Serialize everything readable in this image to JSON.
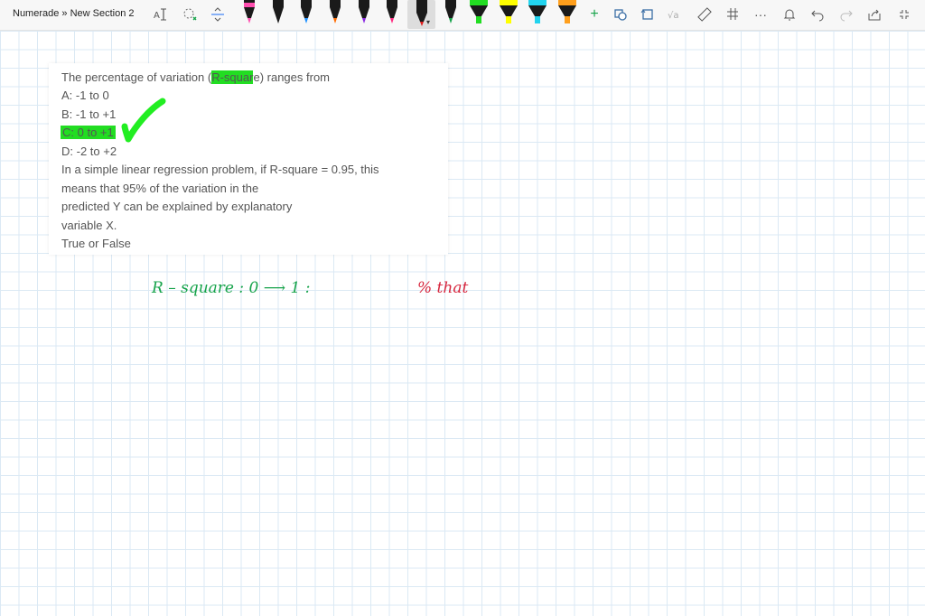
{
  "toolbar": {
    "breadcrumb": "Numerade » New Section 2",
    "pens": [
      {
        "name": "pen-black",
        "color": "#000000",
        "accent": "#ff4fb0"
      },
      {
        "name": "pen-black",
        "color": "#000000",
        "accent": "#1a1a1a"
      },
      {
        "name": "pen-black",
        "color": "#000000",
        "accent": "#1e90ff"
      },
      {
        "name": "pen-black",
        "color": "#000000",
        "accent": "#ff6a00"
      },
      {
        "name": "pen-black",
        "color": "#000000",
        "accent": "#8a2be2"
      },
      {
        "name": "pen-black",
        "color": "#000000",
        "accent": "#ff2a80"
      },
      {
        "name": "pen-red",
        "color": "#000000",
        "accent": "#e01b1b"
      },
      {
        "name": "pen-green",
        "color": "#000000",
        "accent": "#16a34a"
      },
      {
        "name": "highlighter-green",
        "color": "#22dd22",
        "accent": "#22dd22"
      },
      {
        "name": "highlighter-yellow",
        "color": "#ffff00",
        "accent": "#ffff00"
      },
      {
        "name": "highlighter-cyan",
        "color": "#22d3ee",
        "accent": "#22d3ee"
      },
      {
        "name": "highlighter-orange",
        "color": "#ff9f1c",
        "accent": "#ff9f1c"
      }
    ],
    "selected_pen_index": 6
  },
  "question": {
    "line1_pre": "The percentage of variation (",
    "line1_hl": "R-squar",
    "line1_post": "e) ranges from",
    "option_a": "A: -1 to 0",
    "option_b": "B: -1 to +1",
    "option_c": "C: 0 to +1",
    "option_d": "D: -2 to +2",
    "q2_line1": "In a simple linear regression problem, if R-square = 0.95, this",
    "q2_line2": "means that 95% of the variation in the",
    "q2_line3": "predicted Y can be explained by explanatory",
    "q2_line4": "variable X.",
    "q2_line5": "True or False"
  },
  "handwriting": {
    "green_text": "R – square  :    0 ⟶ 1  :",
    "red_text": "%  that",
    "colors": {
      "green": "#16a34a",
      "red": "#d7263d",
      "check": "#22ee22",
      "highlight": "#22dd22"
    }
  }
}
